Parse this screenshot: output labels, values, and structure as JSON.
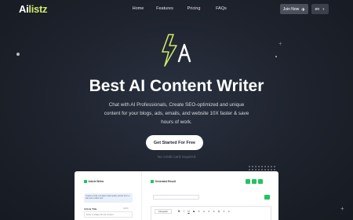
{
  "nav": {
    "logo_main": "Ai",
    "logo_accent": "listz",
    "links": [
      "Home",
      "Features",
      "Pricing",
      "FAQs"
    ],
    "join_label": "Join Now",
    "lang_label": "en"
  },
  "hero": {
    "title": "Best AI Content Writer",
    "subtitle": "Chat with AI Professionals, Create SEO-optimized and unique content for your blogs, ads, emails, and website 10X faster & save hours of work.",
    "cta_label": "Get Started For Free",
    "no_card": "No credit card required"
  },
  "mock": {
    "left_title": "Article Writer",
    "hint": "Create a fully complete high quality article from a title and outline text",
    "field_label": "Article Title",
    "field_count": "0/200",
    "field_placeholder": "Enter a subject for the content",
    "right_title": "Generated Result",
    "toolbar_paragraph": "Paragraph",
    "toolbar_items": [
      "B",
      "I",
      "U",
      "S",
      "≡",
      "≡",
      "≡",
      "≡",
      "≡",
      "≡",
      "≡"
    ]
  },
  "colors": {
    "accent": "#cde86a",
    "success": "#22c55e",
    "background": "#1d222c"
  },
  "icons": {
    "hero": "bolt-a-icon",
    "join": "login-arrow-icon",
    "lang": "chevron-down-icon"
  }
}
